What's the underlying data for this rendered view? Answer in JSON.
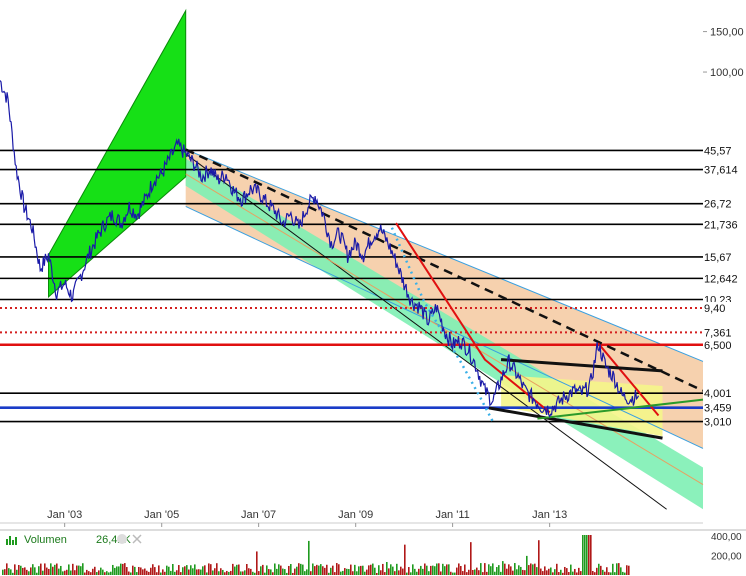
{
  "chart_data": {
    "type": "line",
    "y_scale": "log",
    "ylim": [
      1.1,
      190
    ],
    "x_range": [
      "2001-09-01",
      "2016-03-01"
    ],
    "x_ticks": [
      {
        "date": "2003-01-01",
        "label": "Jan '03"
      },
      {
        "date": "2005-01-01",
        "label": "Jan '05"
      },
      {
        "date": "2007-01-01",
        "label": "Jan '07"
      },
      {
        "date": "2009-01-01",
        "label": "Jan '09"
      },
      {
        "date": "2011-01-01",
        "label": "Jan '11"
      },
      {
        "date": "2013-01-01",
        "label": "Jan '13"
      }
    ],
    "y_ticks": [
      {
        "value": 150,
        "label": "150,00"
      },
      {
        "value": 100,
        "label": "100,00"
      }
    ],
    "price_series": {
      "name": "",
      "color": "#1a1aa8",
      "points": [
        [
          "2001-09-01",
          92
        ],
        [
          "2001-11-01",
          75
        ],
        [
          "2002-01-01",
          38
        ],
        [
          "2002-03-01",
          26
        ],
        [
          "2002-05-01",
          21
        ],
        [
          "2002-07-01",
          14
        ],
        [
          "2002-09-01",
          16
        ],
        [
          "2002-11-01",
          11
        ],
        [
          "2003-01-01",
          12
        ],
        [
          "2003-03-01",
          10.5
        ],
        [
          "2003-05-01",
          13
        ],
        [
          "2003-07-01",
          16
        ],
        [
          "2003-09-01",
          19
        ],
        [
          "2003-11-01",
          22
        ],
        [
          "2004-01-01",
          24
        ],
        [
          "2004-03-01",
          22
        ],
        [
          "2004-05-01",
          26
        ],
        [
          "2004-07-01",
          24
        ],
        [
          "2004-09-01",
          28
        ],
        [
          "2004-11-01",
          34
        ],
        [
          "2005-01-01",
          36
        ],
        [
          "2005-03-01",
          42
        ],
        [
          "2005-05-01",
          48
        ],
        [
          "2005-07-01",
          44
        ],
        [
          "2005-09-01",
          40
        ],
        [
          "2005-11-01",
          35
        ],
        [
          "2006-01-01",
          38
        ],
        [
          "2006-03-01",
          34
        ],
        [
          "2006-05-01",
          36
        ],
        [
          "2006-07-01",
          30
        ],
        [
          "2006-09-01",
          28
        ],
        [
          "2006-11-01",
          31
        ],
        [
          "2007-01-01",
          30
        ],
        [
          "2007-03-01",
          27
        ],
        [
          "2007-05-01",
          25
        ],
        [
          "2007-07-01",
          22
        ],
        [
          "2007-09-01",
          24
        ],
        [
          "2007-11-01",
          21
        ],
        [
          "2008-01-01",
          26
        ],
        [
          "2008-03-01",
          29
        ],
        [
          "2008-05-01",
          24
        ],
        [
          "2008-07-01",
          18
        ],
        [
          "2008-09-01",
          20
        ],
        [
          "2008-11-01",
          16
        ],
        [
          "2009-01-01",
          18
        ],
        [
          "2009-03-01",
          16
        ],
        [
          "2009-05-01",
          19
        ],
        [
          "2009-07-01",
          21
        ],
        [
          "2009-09-01",
          18
        ],
        [
          "2009-11-01",
          15
        ],
        [
          "2010-01-01",
          12
        ],
        [
          "2010-03-01",
          10
        ],
        [
          "2010-05-01",
          9.5
        ],
        [
          "2010-07-01",
          8.2
        ],
        [
          "2010-09-01",
          9.5
        ],
        [
          "2010-11-01",
          7.5
        ],
        [
          "2011-01-01",
          6.5
        ],
        [
          "2011-03-01",
          6.8
        ],
        [
          "2011-05-01",
          6.2
        ],
        [
          "2011-07-01",
          5.2
        ],
        [
          "2011-09-01",
          4.1
        ],
        [
          "2011-11-01",
          3.7
        ],
        [
          "2012-01-01",
          4.6
        ],
        [
          "2012-03-01",
          5.5
        ],
        [
          "2012-05-01",
          4.8
        ],
        [
          "2012-07-01",
          4.1
        ],
        [
          "2012-09-01",
          3.8
        ],
        [
          "2012-11-01",
          3.5
        ],
        [
          "2013-01-01",
          3.4
        ],
        [
          "2013-03-01",
          3.6
        ],
        [
          "2013-05-01",
          3.9
        ],
        [
          "2013-07-01",
          4.1
        ],
        [
          "2013-09-01",
          4.0
        ],
        [
          "2013-11-01",
          4.3
        ],
        [
          "2014-01-01",
          6.6
        ],
        [
          "2014-03-01",
          5.2
        ],
        [
          "2014-05-01",
          4.7
        ],
        [
          "2014-07-01",
          3.9
        ],
        [
          "2014-09-01",
          3.8
        ],
        [
          "2014-11-01",
          3.9
        ]
      ]
    },
    "horizontal_levels": [
      {
        "value": 45.57,
        "label": "45,57",
        "color": "#000000",
        "style": "solid"
      },
      {
        "value": 37.614,
        "label": "37,614",
        "color": "#000000",
        "style": "solid"
      },
      {
        "value": 26.72,
        "label": "26,72",
        "color": "#000000",
        "style": "solid"
      },
      {
        "value": 21.736,
        "label": "21,736",
        "color": "#000000",
        "style": "solid"
      },
      {
        "value": 15.67,
        "label": "15,67",
        "color": "#000000",
        "style": "solid"
      },
      {
        "value": 12.642,
        "label": "12,642",
        "color": "#000000",
        "style": "solid"
      },
      {
        "value": 10.23,
        "label": "10,23",
        "color": "#000000",
        "style": "solid"
      },
      {
        "value": 9.4,
        "label": "9,40",
        "color": "#d42020",
        "style": "dotted"
      },
      {
        "value": 7.361,
        "label": "7,361",
        "color": "#d42020",
        "style": "dotted"
      },
      {
        "value": 6.5,
        "label": "6,500",
        "color": "#e01010",
        "style": "solid"
      },
      {
        "value": 4.001,
        "label": "4,001",
        "color": "#000000",
        "style": "solid"
      },
      {
        "value": 3.459,
        "label": "3,459",
        "color": "#1a3cc8",
        "style": "solid"
      },
      {
        "value": 3.01,
        "label": "3,010",
        "color": "#000000",
        "style": "solid"
      }
    ],
    "volume": {
      "label": "Volumen",
      "value_label": "26,42K",
      "y_ticks": [
        {
          "value": 400,
          "label": "400,00"
        },
        {
          "value": 200,
          "label": "200,00"
        }
      ]
    },
    "colors": {
      "up_channel": "#16e016",
      "orange_channel": "#f5c9a0",
      "green_channel": "#7ef0b4",
      "triangle": "#f5f58a",
      "price": "#1a1aa8",
      "volume_up": "#1e9a1e",
      "volume_down": "#b01818"
    }
  }
}
